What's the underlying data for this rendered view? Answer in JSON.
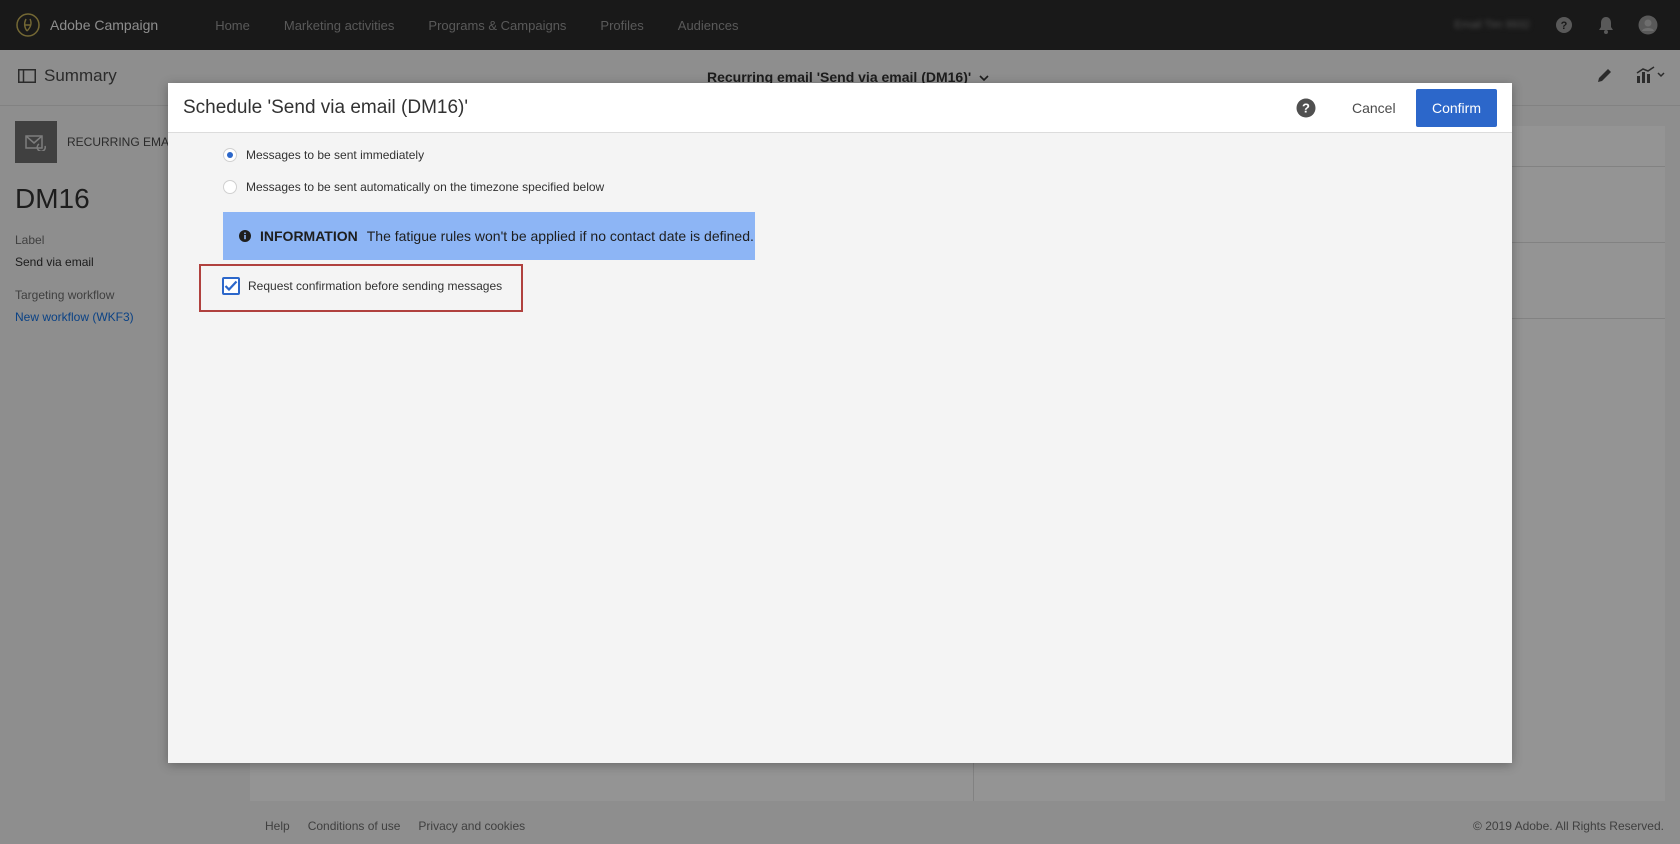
{
  "topbar": {
    "brand": "Adobe Campaign",
    "nav": [
      "Home",
      "Marketing activities",
      "Programs & Campaigns",
      "Profiles",
      "Audiences"
    ],
    "org_name": "Email Tim 9932",
    "icons": [
      "help-icon",
      "bell-icon",
      "avatar-icon"
    ]
  },
  "subheader": {
    "summary_label": "Summary",
    "title": "Recurring email 'Send via email (DM16)'",
    "icons": [
      "edit-icon",
      "report-icon"
    ]
  },
  "left_panel": {
    "type_label": "RECURRING EMAIL",
    "id": "DM16",
    "label_caption": "Label",
    "label_value": "Send via email",
    "workflow_caption": "Targeting workflow",
    "workflow_link": "New workflow (WKF3)"
  },
  "footer": {
    "links": [
      "Help",
      "Conditions of use",
      "Privacy and cookies"
    ],
    "copyright": "© 2019 Adobe. All Rights Reserved."
  },
  "dialog": {
    "title": "Schedule 'Send via email (DM16)'",
    "cancel_label": "Cancel",
    "confirm_label": "Confirm",
    "options": [
      {
        "label": "Messages to be sent immediately",
        "selected": true
      },
      {
        "label": "Messages to be sent automatically on the timezone specified below",
        "selected": false
      }
    ],
    "info": {
      "title": "INFORMATION",
      "text": "The fatigue rules won't be applied if no contact date is defined."
    },
    "confirmation_checkbox": {
      "label": "Request confirmation before sending messages",
      "checked": true
    }
  },
  "colors": {
    "accent": "#2c67ca",
    "info_bg": "#8db5f5",
    "highlight": "#b0413e",
    "topbar": "#2b2b2b"
  }
}
